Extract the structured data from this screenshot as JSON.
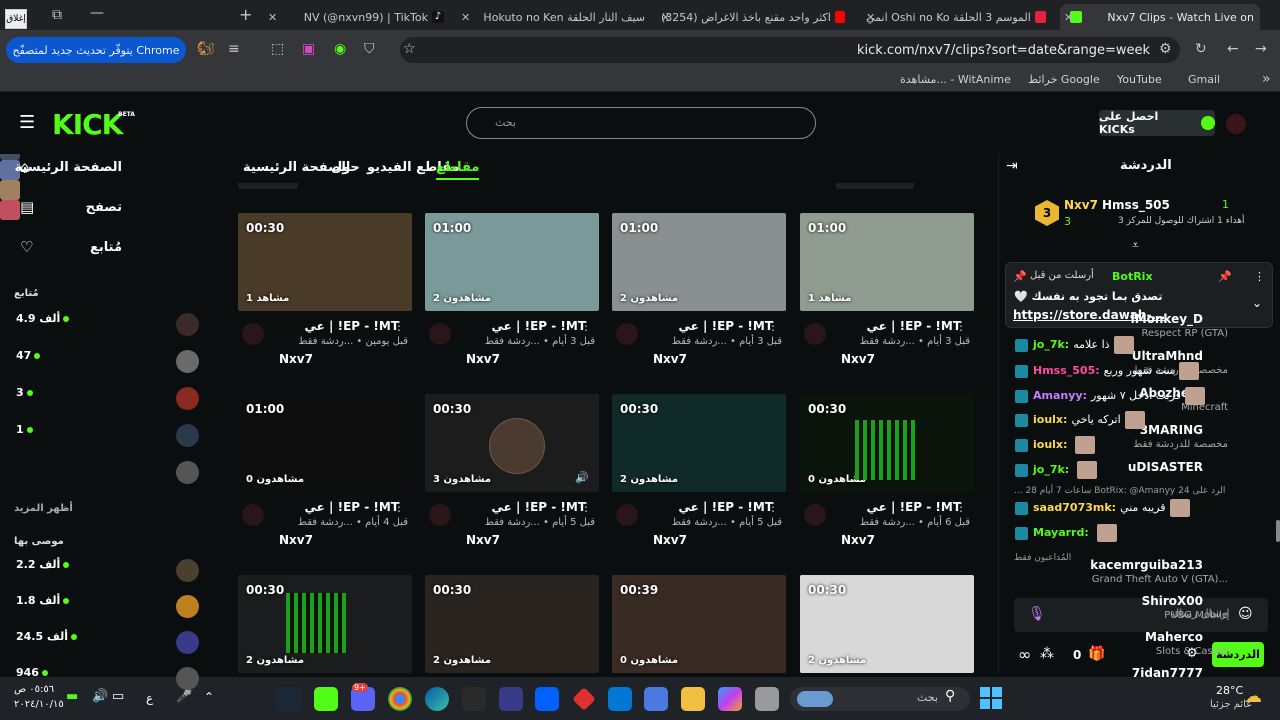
{
  "browser": {
    "tabs": [
      {
        "label": "Nxv7 Clips - Watch Live on",
        "active": true
      },
      {
        "label": "انمي Oshi no Ko الموسم 3 الحلقة"
      },
      {
        "label": "(3254) اكثر واحد مقنع باخذ الاغراض"
      },
      {
        "label": "Hokuto no Ken سيف النار الحلقة"
      },
      {
        "label": "NV (@nxvn99) | TikTok"
      }
    ],
    "url": "kick.com/nxv7/clips?sort=date&range=week",
    "update_button": "يتوفّر تحديث جديد لمتصفّح Chrome",
    "close_tooltip": "إغلاق",
    "bookmarks": [
      "Gmail",
      "YouTube",
      "خرائط Google",
      "مشاهدة... - WitAnime"
    ]
  },
  "kick": {
    "logo": "KICK",
    "beta": "BETA",
    "search_placeholder": "بحث",
    "get_kicks": "احصل على KICKs"
  },
  "sidebar": {
    "nav": [
      "الصفحة الرئيسية",
      "تصفح",
      "مُتابع"
    ],
    "following_header": "مُتابع",
    "following": [
      {
        "name": "iMonkey_D",
        "game": "Respect RP (GTA)",
        "count": "4.9 ألف",
        "avatar": "#3a2a2a"
      },
      {
        "name": "UltraMhnd",
        "game": "مخصصة للدردشة فقط",
        "count": "47",
        "avatar": "#6a6a6a"
      },
      {
        "name": "Abozhera",
        "game": "Minecraft",
        "count": "3",
        "avatar": "#8a2a20"
      },
      {
        "name": "3MARING",
        "game": "مخصصة للدردشة فقط",
        "count": "1",
        "avatar": "#2a3a4a"
      },
      {
        "name": "uDISASTER",
        "game": "",
        "count": "",
        "avatar": "#555"
      }
    ],
    "show_more": "أظهر المزيد",
    "recommended_header": "موصى بها",
    "recommended": [
      {
        "name": "kacemrguiba213",
        "game": "Grand Theft Auto V (GTA)...",
        "count": "2.2 ألف",
        "avatar": "#4a4030"
      },
      {
        "name": "ShiroX00",
        "game": "PUBG Mobile",
        "count": "1.8 ألف",
        "avatar": "#c08020"
      },
      {
        "name": "Maherco",
        "game": "Slots & Casino",
        "count": "24.5 ألف",
        "avatar": "#3a3a8a"
      },
      {
        "name": "7idan7777",
        "game": "",
        "count": "946",
        "avatar": "#555"
      }
    ]
  },
  "tabs": [
    "الصفحة الرئيسية",
    "حول",
    "مقاطع الفيديو",
    "مقاطع"
  ],
  "clips": [
    {
      "dur": "00:30",
      "views": "مشاهد 1",
      "title": "عي | !EP - !MT",
      "meta": "قبل يومين • ...ردشة فقط",
      "channel": "Nxv7",
      "bg": "#4a3a28"
    },
    {
      "dur": "01:00",
      "views": "مشاهدون 2",
      "title": "عي | !EP - !MT",
      "meta": "قبل 3 أيام • ...ردشة فقط",
      "channel": "Nxv7",
      "bg": "#7a9a9a"
    },
    {
      "dur": "01:00",
      "views": "مشاهدون 2",
      "title": "عي | !EP - !MT",
      "meta": "قبل 3 أيام • ...ردشة فقط",
      "channel": "Nxv7",
      "bg": "#8a9090"
    },
    {
      "dur": "01:00",
      "views": "مشاهد 1",
      "title": "عي | !EP - !MT",
      "meta": "قبل 3 أيام • ...ردشة فقط",
      "channel": "Nxv7",
      "bg": "#909c90"
    },
    {
      "dur": "01:00",
      "views": "مشاهدون 0",
      "title": "عي | !EP - !MT",
      "meta": "قبل 4 أيام • ...ردشة فقط",
      "channel": "Nxv7",
      "bg": "#0e0e0e"
    },
    {
      "dur": "00:30",
      "views": "مشاهدون 3",
      "title": "عي | !EP - !MT",
      "meta": "قبل 5 أيام • ...ردشة فقط",
      "channel": "Nxv7",
      "bg": "#1c1c1c"
    },
    {
      "dur": "00:30",
      "views": "مشاهدون 2",
      "title": "عي | !EP - !MT",
      "meta": "قبل 5 أيام • ...ردشة فقط",
      "channel": "Nxv7",
      "bg": "#102a2a"
    },
    {
      "dur": "00:30",
      "views": "مشاهدون 0",
      "title": "عي | !EP - !MT",
      "meta": "قبل 6 أيام • ...ردشة فقط",
      "channel": "Nxv7",
      "bg": "#0a140a"
    },
    {
      "dur": "00:30",
      "views": "مشاهدون 2",
      "bg": "#1a1c1e"
    },
    {
      "dur": "00:30",
      "views": "مشاهدون 2",
      "bg": "#2a2420"
    },
    {
      "dur": "00:39",
      "views": "مشاهدون 0",
      "bg": "#3a2a24"
    },
    {
      "dur": "00:30",
      "views": "مشاهدون 2",
      "bg": "#d8d8d8"
    }
  ],
  "chat": {
    "title": "الدردشة",
    "top_gifter": {
      "name": "Hmss_505",
      "count": "1",
      "sub": "أهداء 1 اشتراك للوصول للمركز 3",
      "rank": "3"
    },
    "streamer": {
      "name": "Nxv7",
      "count": "3"
    },
    "pinned_by": "أرسلت من قبل",
    "pinned_user": "BotRix",
    "pinned_text": "تصدق بما تجود به نفسك 🤍",
    "pinned_link": "https://store.dawah-...",
    "messages": [
      {
        "user": "jo_7k:",
        "text": "ذا علامه",
        "color": "#53fc18"
      },
      {
        "user": "Hmss_505:",
        "text": "ست شهور وربع",
        "color": "#ff4aa0"
      },
      {
        "user": "Amanyy:",
        "text": "قربت ادخل ٧ شهور",
        "color": "#c77dff"
      },
      {
        "user": "ioulx:",
        "text": "اتركه ياخي",
        "color": "#ffd84a"
      },
      {
        "user": "ioulx:",
        "text": "",
        "color": "#ffd84a"
      },
      {
        "user": "jo_7k:",
        "text": "",
        "color": "#53fc18"
      },
      {
        "user": "saad7073mk:",
        "text": "قريبه مني",
        "color": "#ffd84a"
      },
      {
        "user": "Mayarrd:",
        "text": "",
        "color": "#53fc18"
      }
    ],
    "reply_meta": "الرد على BotRix: @Amanyy 24 ساعات 7 أيام 28 ...",
    "senders_label": "المُداعبون فقط",
    "input_placeholder": "إرسال رسالة",
    "send_button": "الدردشة",
    "points": "0"
  },
  "taskbar": {
    "search": "بحث",
    "weather_temp": "28°C",
    "weather_desc": "غائم جزئيا",
    "time": "٠٥:٥٦ ص",
    "date": "٢٠٢٤/١٠/١٥",
    "discord_badge": "9+"
  }
}
